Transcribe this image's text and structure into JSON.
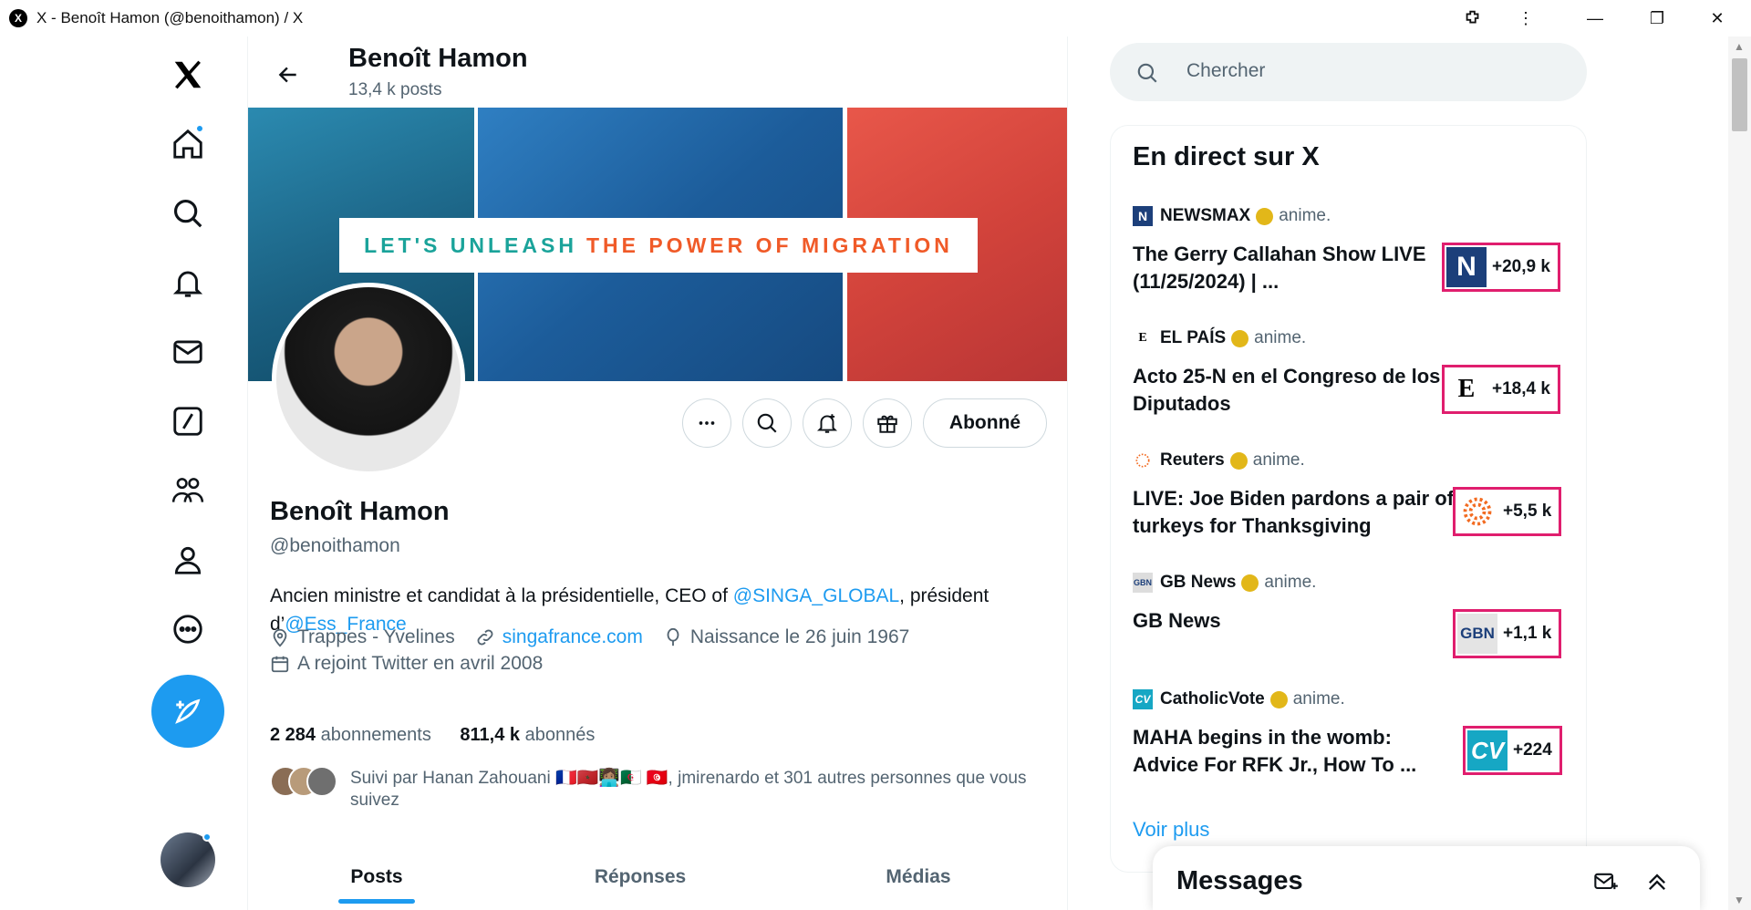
{
  "window": {
    "title": "X - Benoît Hamon (@benoithamon) / X"
  },
  "header": {
    "name": "Benoît Hamon",
    "posts_count": "13,4 k posts"
  },
  "banner": {
    "text_part1": "LET'S UNLEASH",
    "text_part2": "THE POWER OF MIGRATION"
  },
  "profile": {
    "name": "Benoît Hamon",
    "handle": "@benoithamon",
    "bio_prefix": "Ancien ministre et candidat à la présidentielle, CEO of ",
    "bio_link1": "@SINGA_GLOBAL",
    "bio_middle": ", président d’",
    "bio_link2": "@Ess_France",
    "location": "Trappes - Yvelines",
    "website": "singafrance.com",
    "birthday": "Naissance le 26 juin 1967",
    "joined": "A rejoint Twitter en avril 2008",
    "following_count": "2 284",
    "following_label": "abonnements",
    "followers_count": "811,4 k",
    "followers_label": "abonnés",
    "followed_by": "Suivi par Hanan Zahouani 🇫🇷🇲🇦👩🏽‍💻🇩🇿 🇹🇳, jmirenardo et 301 autres personnes que vous suivez",
    "follow_button": "Abonné"
  },
  "tabs": [
    {
      "label": "Posts"
    },
    {
      "label": "Réponses"
    },
    {
      "label": "Médias"
    }
  ],
  "search": {
    "placeholder": "Chercher"
  },
  "live": {
    "title": "En direct sur X",
    "anime_label": "anime.",
    "items": [
      {
        "source": "NEWSMAX",
        "title": "The Gerry Callahan Show LIVE (11/25/2024) | ...",
        "count": "+20,9 k",
        "logo": "N"
      },
      {
        "source": "EL PAÍS",
        "title": "Acto 25-N en el Congreso de los Diputados",
        "count": "+18,4 k",
        "logo": "E"
      },
      {
        "source": "Reuters",
        "title": "LIVE: Joe Biden pardons a pair of turkeys for Thanksgiving",
        "count": "+5,5 k",
        "logo": "reuters-icon"
      },
      {
        "source": "GB News",
        "title": "GB News",
        "count": "+1,1 k",
        "logo": "GBN"
      },
      {
        "source": "CatholicVote",
        "title": "MAHA begins in the womb: Advice For RFK Jr., How To ...",
        "count": "+224",
        "logo": "CV"
      }
    ],
    "see_more": "Voir plus"
  },
  "messages": {
    "title": "Messages"
  },
  "colors": {
    "accent": "#1d9bf0",
    "highlight_border": "#e01e6e",
    "verified": "#e2b719"
  }
}
